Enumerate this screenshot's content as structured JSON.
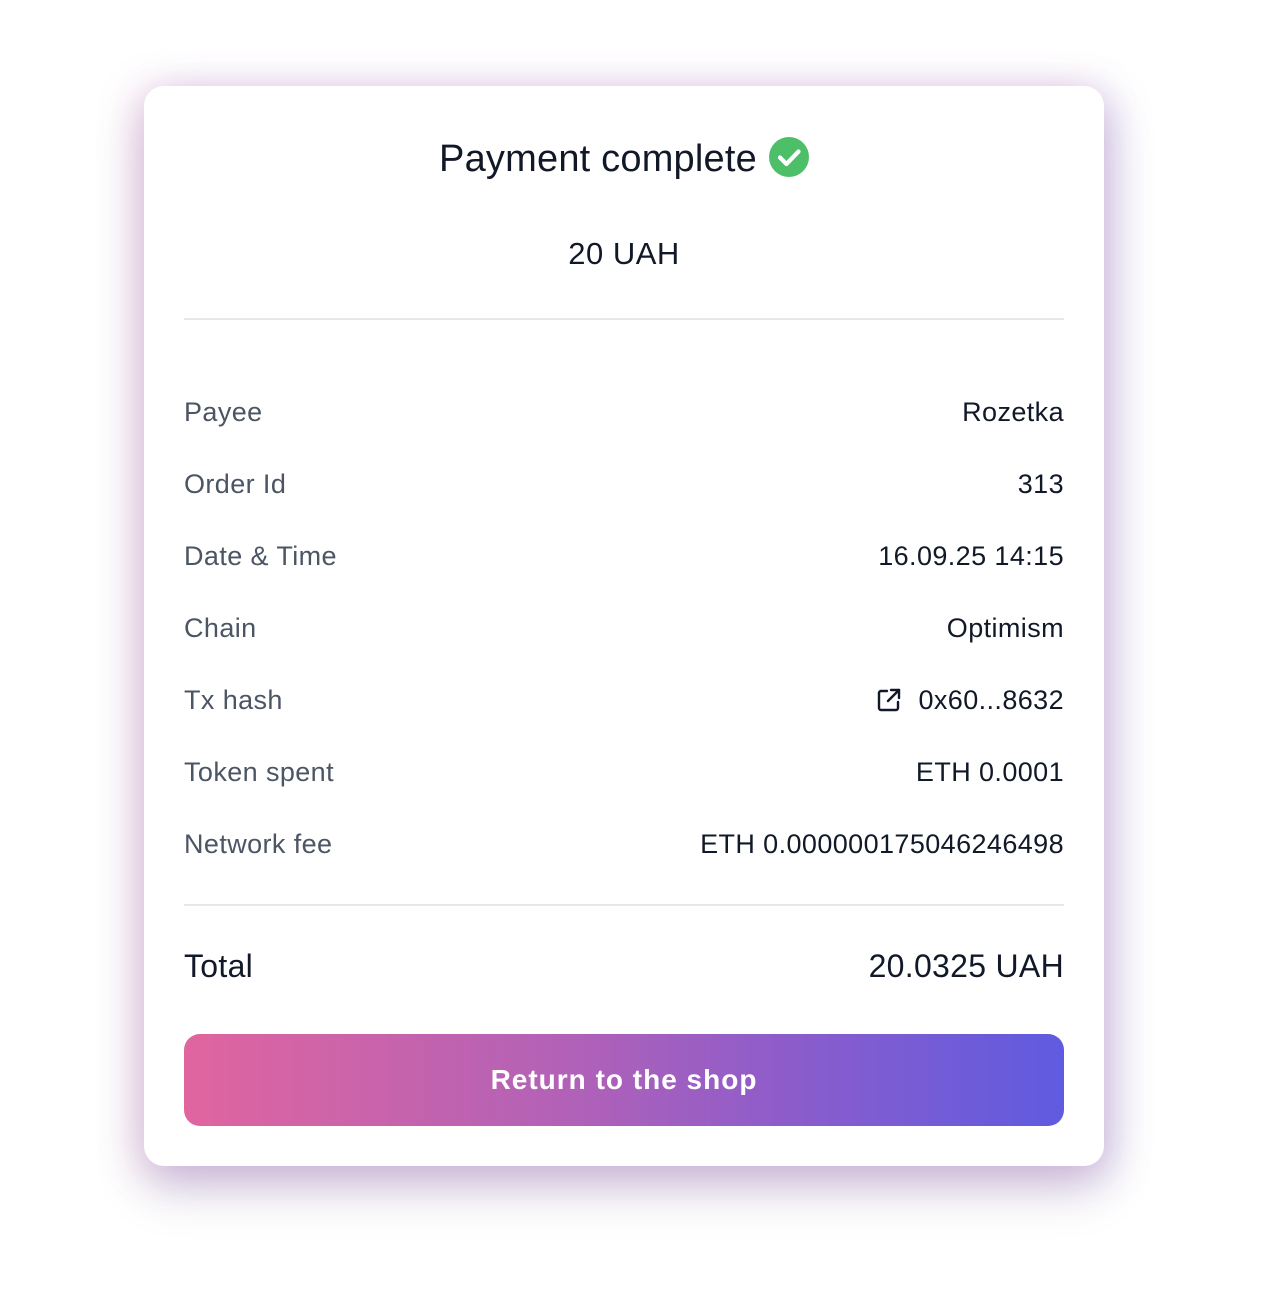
{
  "header": {
    "title": "Payment complete",
    "status_icon": "check-circle-icon",
    "status_color": "#4cbf68"
  },
  "amount": "20 UAH",
  "details": [
    {
      "label": "Payee",
      "value": "Rozetka"
    },
    {
      "label": "Order Id",
      "value": "313"
    },
    {
      "label": "Date & Time",
      "value": "16.09.25 14:15"
    },
    {
      "label": "Chain",
      "value": "Optimism"
    },
    {
      "label": "Tx hash",
      "value": "0x60...8632",
      "icon": "external-link-icon"
    },
    {
      "label": "Token spent",
      "value": "ETH 0.0001"
    },
    {
      "label": "Network fee",
      "value": "ETH 0.000000175046246498"
    }
  ],
  "total": {
    "label": "Total",
    "value": "20.0325 UAH"
  },
  "cta": {
    "label": "Return to the shop",
    "gradient_start": "#e0659f",
    "gradient_end": "#5f5be0"
  }
}
